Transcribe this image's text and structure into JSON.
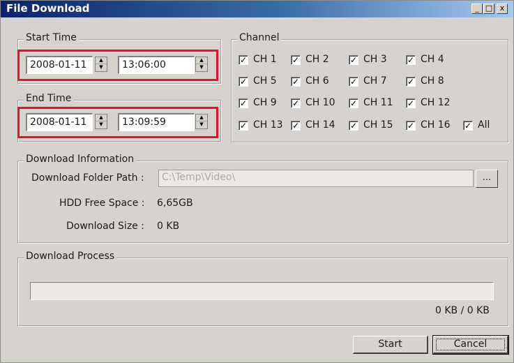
{
  "window": {
    "title": "File Download",
    "minimize": "_",
    "maximize": "□",
    "close": "x"
  },
  "start_time": {
    "label": "Start Time",
    "date": "2008-01-11",
    "time": "13:06:00"
  },
  "end_time": {
    "label": "End Time",
    "date": "2008-01-11",
    "time": "13:09:59"
  },
  "channel": {
    "label": "Channel",
    "items": [
      {
        "label": "CH 1",
        "checked": true
      },
      {
        "label": "CH 2",
        "checked": true
      },
      {
        "label": "CH 3",
        "checked": true
      },
      {
        "label": "CH 4",
        "checked": true
      },
      {
        "label": "CH 5",
        "checked": true
      },
      {
        "label": "CH 6",
        "checked": true
      },
      {
        "label": "CH 7",
        "checked": true
      },
      {
        "label": "CH 8",
        "checked": true
      },
      {
        "label": "CH 9",
        "checked": true
      },
      {
        "label": "CH 10",
        "checked": true
      },
      {
        "label": "CH 11",
        "checked": true
      },
      {
        "label": "CH 12",
        "checked": true
      },
      {
        "label": "CH 13",
        "checked": true
      },
      {
        "label": "CH 14",
        "checked": true
      },
      {
        "label": "CH 15",
        "checked": true
      },
      {
        "label": "CH 16",
        "checked": true
      }
    ],
    "all": {
      "label": "All",
      "checked": true
    }
  },
  "download_info": {
    "label": "Download Information",
    "folder_label": "Download Folder Path :",
    "folder_path": "C:\\Temp\\Video\\",
    "browse_label": "...",
    "free_space_label": "HDD Free Space :",
    "free_space": "6,65GB",
    "size_label": "Download Size :",
    "size": "0 KB"
  },
  "download_process": {
    "label": "Download Process",
    "progress": 0,
    "status": "0 KB / 0 KB"
  },
  "buttons": {
    "start": "Start",
    "cancel": "Cancel"
  },
  "colors": {
    "highlight_box": "#e8112d",
    "dialog_bg": "#d6d3ce",
    "title_bar": "#0a246a"
  }
}
